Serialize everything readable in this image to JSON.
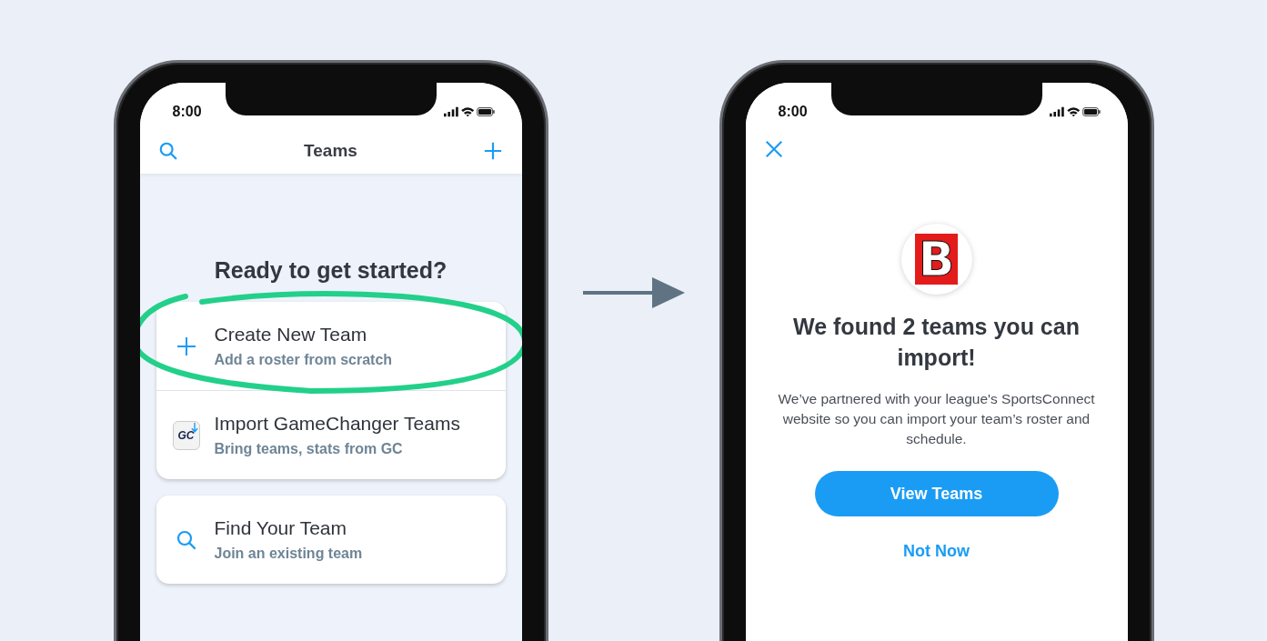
{
  "teams_screen": {
    "status_time": "8:00",
    "nav_title": "Teams",
    "heading": "Ready to get started?",
    "option_groups": [
      {
        "options": [
          {
            "kind": "create",
            "title": "Create New Team",
            "subtitle": "Add a roster from scratch",
            "highlighted": true
          },
          {
            "kind": "import",
            "title": "Import GameChanger Teams",
            "subtitle": "Bring teams, stats from GC",
            "icon_text": "GC",
            "highlighted": false
          }
        ]
      },
      {
        "options": [
          {
            "kind": "find",
            "title": "Find Your Team",
            "subtitle": "Join an existing team",
            "highlighted": false
          }
        ]
      }
    ]
  },
  "import_screen": {
    "status_time": "8:00",
    "logo_letter": "B",
    "heading": "We found 2 teams you can import!",
    "message": "We’ve partnered with your league's SportsConnect website so you can import your team’s roster and schedule.",
    "primary_button": "View Teams",
    "secondary_link": "Not Now"
  }
}
